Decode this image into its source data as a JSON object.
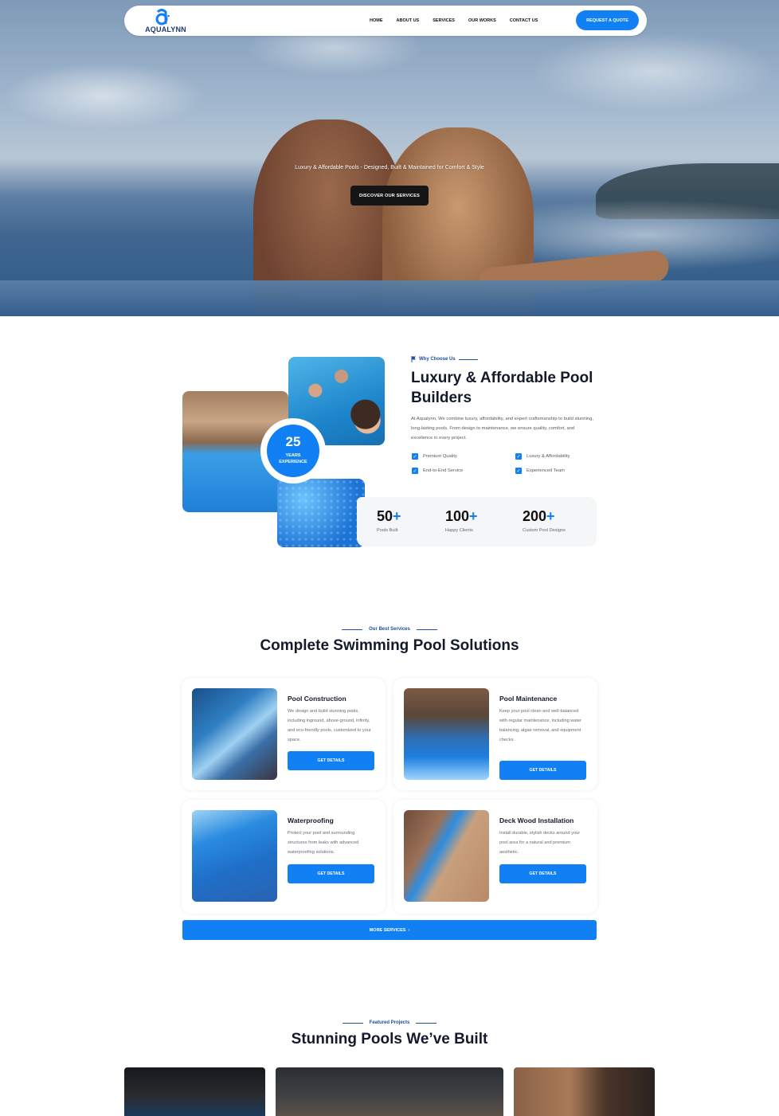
{
  "brand": {
    "name": "AQUALYNN",
    "accent": "#1180f5",
    "dark": "#141a2a"
  },
  "nav": {
    "links": [
      "HOME",
      "ABOUT US",
      "SERVICES",
      "OUR WORKS",
      "CONTACT US"
    ],
    "cta": "REQUEST A QUOTE"
  },
  "hero": {
    "tagline": "Luxury & Affordable Pools - Designed, Built & Maintained for Comfort & Style",
    "cta": "DISCOVER OUR SERVICES"
  },
  "why": {
    "eyebrow": "Why Choose Us",
    "title": "Luxury & Affordable Pool Builders",
    "description": "At Aqualynn, We combine luxury, affordability, and expert craftsmanship to build stunning, long-lasting pools. From design to maintenance, we ensure quality, comfort, and excellence in every project.",
    "features": [
      "Premium Quality",
      "Luxury & Affordability",
      "End-to-End Service",
      "Experienced Team"
    ],
    "badge": {
      "number": "25",
      "line1": "YEARS",
      "line2": "EXPERIENCE"
    },
    "stats": [
      {
        "number": "50",
        "plus": "+",
        "label": "Pools Built"
      },
      {
        "number": "100",
        "plus": "+",
        "label": "Happy Clients"
      },
      {
        "number": "200",
        "plus": "+",
        "label": "Custom Pool Designs"
      }
    ]
  },
  "services": {
    "eyebrow": "Our Best Services",
    "title": "Complete Swimming Pool Solutions",
    "items": [
      {
        "title": "Pool Construction",
        "description": "We design and build stunning pools, including inground, above-ground, infinity, and eco-friendly pools, customized to your space.",
        "button": "GET DETAILS"
      },
      {
        "title": "Pool Maintenance",
        "description": "Keep your pool clean and well-balanced with regular maintenance, including water balancing, algae removal, and equipment checks.",
        "button": "GET DETAILS"
      },
      {
        "title": "Waterproofing",
        "description": "Protect your pool and surrounding structures from leaks with advanced waterproofing solutions.",
        "button": "GET DETAILS"
      },
      {
        "title": "Deck Wood Installation",
        "description": "Install durable, stylish decks around your pool area for a natural and premium aesthetic.",
        "button": "GET DETAILS"
      }
    ],
    "more": "MORE SERVICES"
  },
  "projects": {
    "eyebrow": "Featured Projects",
    "title": "Stunning Pools We’ve Built"
  }
}
